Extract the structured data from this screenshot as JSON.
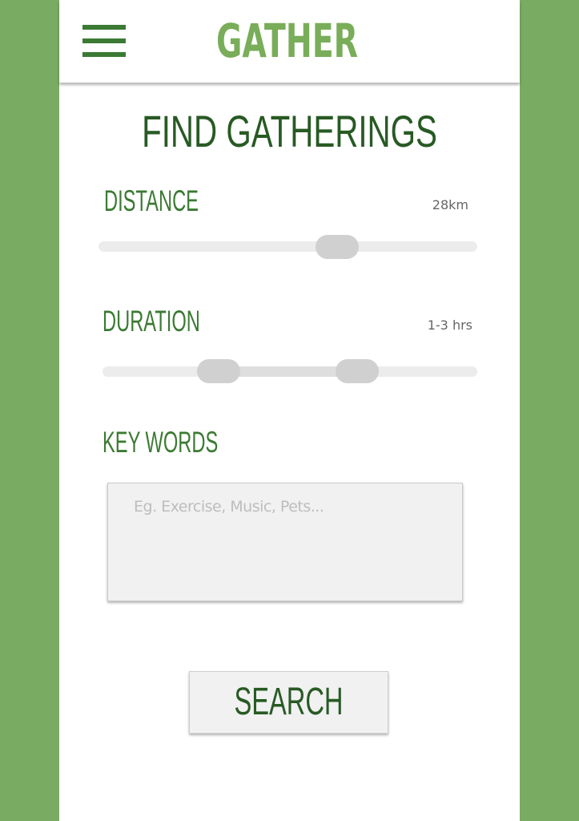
{
  "header": {
    "logo_text": "GATHER",
    "menu_icon": "hamburger-menu-icon"
  },
  "page": {
    "title": "FIND GATHERINGS"
  },
  "distance": {
    "label": "DISTANCE",
    "value_text": "28km",
    "slider_fraction": 0.63
  },
  "duration": {
    "label": "DURATION",
    "value_text": "1-3 hrs",
    "range_fraction": [
      0.31,
      0.68
    ]
  },
  "keywords": {
    "label": "KEY WORDS",
    "placeholder": "Eg. Exercise, Music, Pets...",
    "value": ""
  },
  "search": {
    "label": "SEARCH"
  },
  "colors": {
    "background_green": "#7aab62",
    "logo_green": "#79ad59",
    "label_green": "#3b7a33",
    "title_green": "#285a24",
    "track_gray": "#ececec",
    "thumb_gray": "#d0d0d0"
  }
}
